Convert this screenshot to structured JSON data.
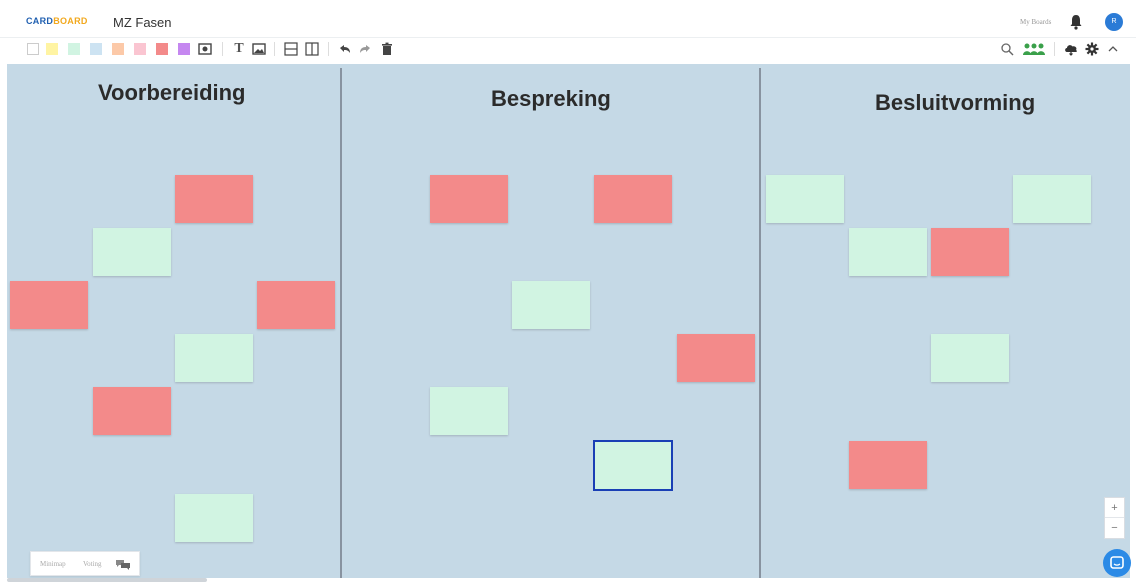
{
  "header": {
    "logo_part1": "CARD",
    "logo_part2": "BOARD",
    "board_title": "MZ Fasen",
    "my_boards": "My Boards",
    "avatar_initial": "R"
  },
  "toolbar": {
    "swatches": [
      "#ffffff",
      "#fff4a3",
      "#d1f4e2",
      "#cde3f2",
      "#fcc9a8",
      "#fac5d1",
      "#f38a8a",
      "#c587f0"
    ],
    "icons": [
      "camera-icon",
      "text-icon",
      "image-icon",
      "row-divider-icon",
      "column-divider-icon",
      "undo-icon",
      "redo-icon",
      "trash-icon"
    ],
    "right_icons": [
      "search-icon",
      "users-icon",
      "cloud-icon",
      "gear-icon",
      "collapse-icon"
    ]
  },
  "columns": [
    {
      "title": "Voorbereiding"
    },
    {
      "title": "Bespreking"
    },
    {
      "title": "Besluitvorming"
    }
  ],
  "card_colors": {
    "red": "#f38a8a",
    "green": "#d1f4e2",
    "board": "#c5d9e6"
  },
  "bottom_panel": {
    "minimap": "Minimap",
    "voting": "Voting"
  },
  "zoom": {
    "in": "+",
    "out": "−"
  }
}
